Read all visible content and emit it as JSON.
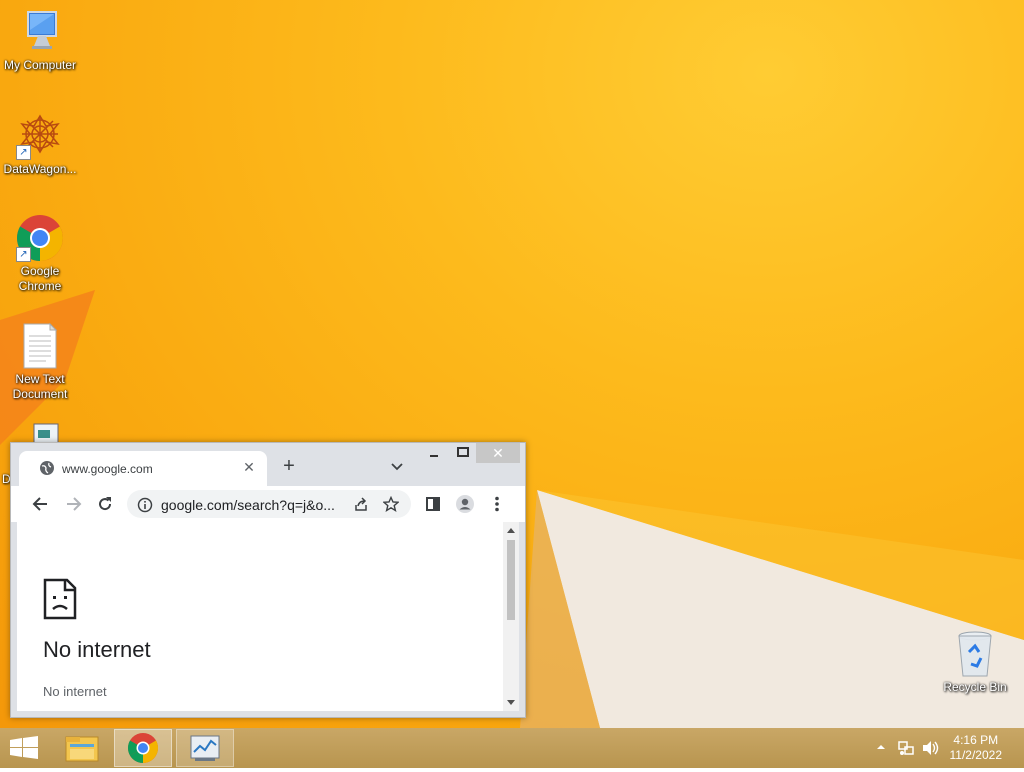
{
  "desktop_icons": [
    {
      "label": "My Computer",
      "icon": "computer-icon"
    },
    {
      "label": "DataWagon...",
      "icon": "datawagon-icon"
    },
    {
      "label": "Google Chrome",
      "icon": "chrome-icon"
    },
    {
      "label": "New Text Document",
      "icon": "text-document-icon"
    },
    {
      "label": "D",
      "icon": "partial-document-icon"
    },
    {
      "label": "Recycle Bin",
      "icon": "recycle-bin-icon"
    }
  ],
  "browser": {
    "tab_title": "www.google.com",
    "url": "google.com/search?q=j&o...",
    "page": {
      "title": "No internet",
      "subtitle": "No internet"
    }
  },
  "taskbar": {
    "time": "4:16 PM",
    "date": "11/2/2022",
    "icons": [
      "start-icon",
      "file-explorer-icon",
      "chrome-icon",
      "app-icon"
    ]
  },
  "colors": {
    "wallpaper": "#fdb51a",
    "taskbar": "#c2a05d",
    "chrome_red": "#db4437",
    "chrome_green": "#0f9d58",
    "chrome_yellow": "#f4b400",
    "chrome_blue": "#4285f4"
  }
}
